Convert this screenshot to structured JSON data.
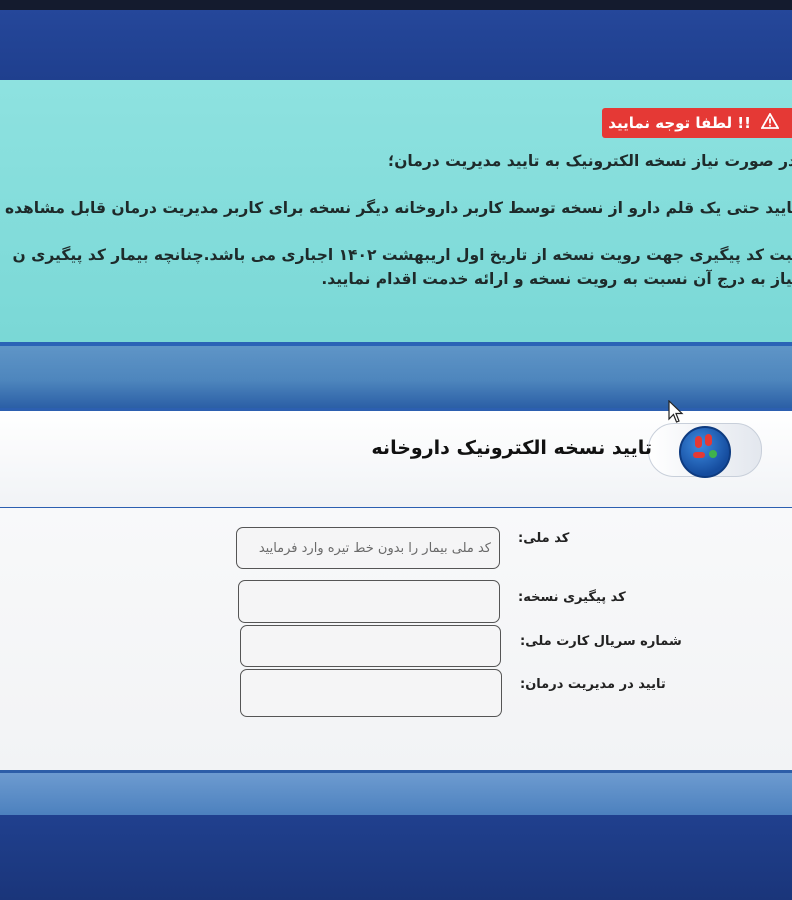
{
  "notice": {
    "alert_label": "!! لطفا توجه نمایید",
    "lines": [
      "در صورت نیاز نسخه الکترونیک به تایید مدیریت درمان؛",
      "تایید حتی یک قلم دارو از نسخه توسط کاربر داروخانه دیگر نسخه برای کاربر مدیریت درمان قابل مشاهده",
      "ثبت کد پیگیری جهت رویت نسخه از تاریخ اول اریبهشت ۱۴۰۲ اجباری می باشد.چنانچه بیمار کد پیگیری ن",
      "نیاز به درج آن نسبت به رویت نسخه و ارائه خدمت اقدام نمایید."
    ]
  },
  "header": {
    "title": "تایید نسخه الکترونیک داروخانه"
  },
  "form": {
    "national_code": {
      "label": "کد ملی:",
      "placeholder": "کد ملی بیمار را بدون خط تیره وارد فرمایید"
    },
    "tracking_code": {
      "label": "کد پیگیری نسخه:"
    },
    "card_serial": {
      "label": "شماره سریال کارت ملی:"
    },
    "treatment_approval": {
      "label": "تایید در مدیریت درمان:"
    }
  },
  "colors": {
    "alert_red": "#e53935",
    "notice_bg": "#8ee2e0",
    "frame_blue": "#2c5fb0"
  }
}
